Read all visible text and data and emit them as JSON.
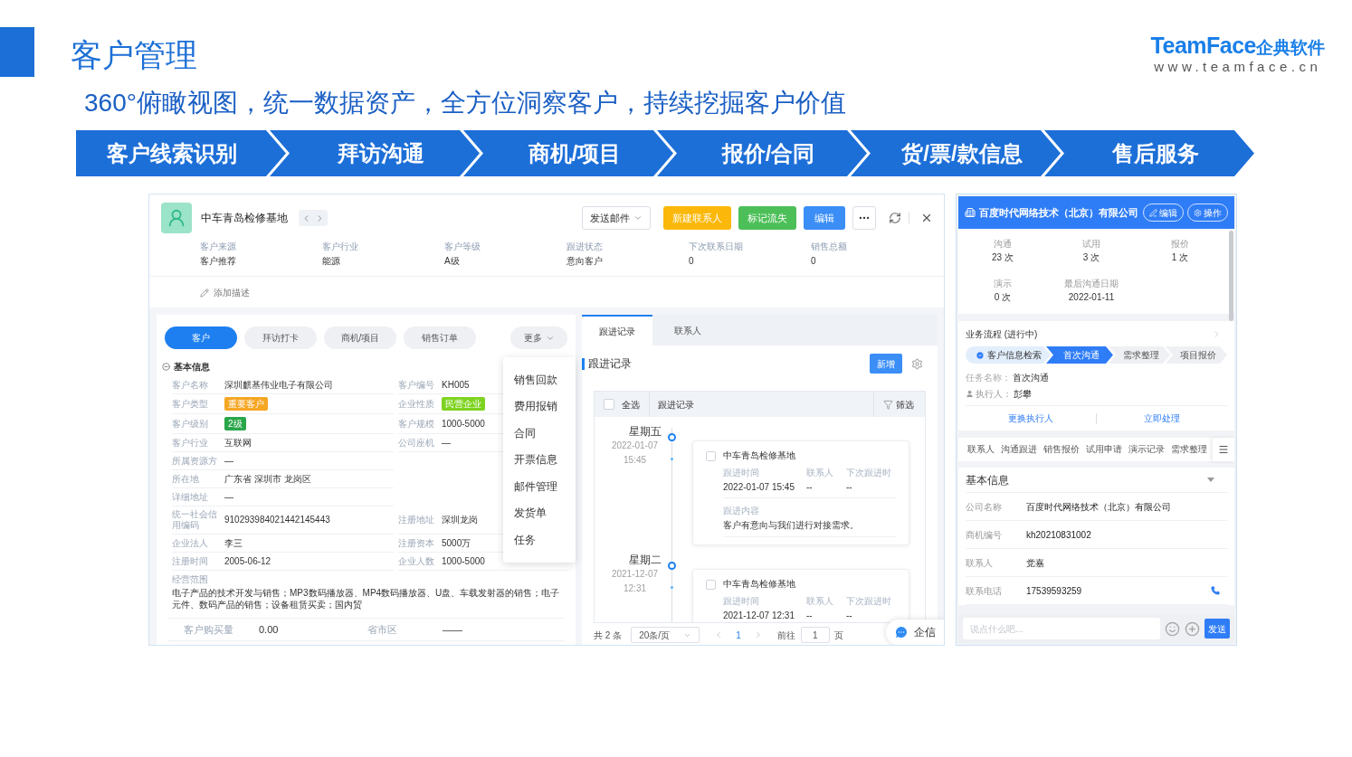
{
  "header": {
    "title": "客户管理",
    "brand_name": "TeamFace",
    "brand_cn": "企典软件",
    "brand_url": "www.teamface.cn",
    "subtitle": "360°俯瞰视图，统一数据资产，全方位洞察客户，持续挖掘客户价值"
  },
  "process_steps": [
    "客户线索识别",
    "拜访沟通",
    "商机/项目",
    "报价/合同",
    "货/票/款信息",
    "售后服务"
  ],
  "customer_detail": {
    "title": "中车青岛检修基地",
    "actions": [
      {
        "label": "发送邮件",
        "kind": "dropdown"
      },
      {
        "label": "新建联系人",
        "kind": "warning"
      },
      {
        "label": "标记流失",
        "kind": "success"
      },
      {
        "label": "编辑",
        "kind": "primary"
      }
    ],
    "summary_fields": [
      {
        "label": "客户来源",
        "value": "客户推荐"
      },
      {
        "label": "客户行业",
        "value": "能源"
      },
      {
        "label": "客户等级",
        "value": "A级"
      },
      {
        "label": "跟进状态",
        "value": "意向客户"
      },
      {
        "label": "下次联系日期",
        "value": "0"
      },
      {
        "label": "销售总额",
        "value": "0"
      }
    ],
    "add_description": "添加描述",
    "tabs": [
      {
        "label": "客户",
        "selected": true
      },
      {
        "label": "拜访打卡",
        "selected": false
      },
      {
        "label": "商机/项目",
        "selected": false
      },
      {
        "label": "销售订单",
        "selected": false
      }
    ],
    "more_button": "更多",
    "more_menu": [
      "销售回款",
      "费用报销",
      "合同",
      "开票信息",
      "邮件管理",
      "发货单",
      "任务"
    ],
    "section_title": "基本信息",
    "info_rows": [
      {
        "left": {
          "label": "客户名称",
          "value": "深圳麒基伟业电子有限公司",
          "kind": "text"
        },
        "right": {
          "label": "客户编号",
          "value": "KH005",
          "kind": "text"
        }
      },
      {
        "left": {
          "label": "客户类型",
          "value": "重要客户",
          "kind": "tag",
          "color": "#f5a623"
        },
        "right": {
          "label": "企业性质",
          "value": "民营企业",
          "kind": "tag",
          "color": "#7ed321"
        }
      },
      {
        "left": {
          "label": "客户级别",
          "value": "2级",
          "kind": "tag",
          "color": "#2aa64a"
        },
        "right": {
          "label": "客户规模",
          "value": "1000-5000",
          "kind": "text"
        }
      },
      {
        "left": {
          "label": "客户行业",
          "value": "互联网",
          "kind": "text"
        },
        "right": {
          "label": "公司座机",
          "value": "—",
          "kind": "text"
        }
      },
      {
        "left": {
          "label": "所属资源方",
          "value": "—",
          "kind": "text"
        }
      },
      {
        "left": {
          "label": "所在地",
          "value": "广东省 深圳市 龙岗区",
          "kind": "text"
        }
      },
      {
        "left": {
          "label": "详细地址",
          "value": "—",
          "kind": "text"
        }
      },
      {
        "left": {
          "label": "统一社会信用编码",
          "value": "910293984021442145443",
          "kind": "text"
        },
        "right": {
          "label": "注册地址",
          "value": "深圳龙岗",
          "kind": "text"
        }
      },
      {
        "left": {
          "label": "企业法人",
          "value": "李三",
          "kind": "text"
        },
        "right": {
          "label": "注册资本",
          "value": "5000万",
          "kind": "text"
        }
      },
      {
        "left": {
          "label": "注册时间",
          "value": "2005-06-12",
          "kind": "text"
        },
        "right": {
          "label": "企业人数",
          "value": "1000-5000",
          "kind": "text"
        }
      }
    ],
    "business_scope": {
      "label": "经营范围",
      "value": "电子产品的技术开发与销售；MP3数码播放器、MP4数码播放器、U盘、车载发射器的销售；电子元件、数码产品的销售；设备租赁买卖；国内贸"
    },
    "totals": [
      {
        "label": "客户购买量",
        "value": "0.00"
      },
      {
        "label": "省市区",
        "value": "——"
      }
    ]
  },
  "follow_up": {
    "tabs": [
      {
        "label": "跟进记录",
        "selected": true
      },
      {
        "label": "联系人",
        "selected": false
      }
    ],
    "title": "跟进记录",
    "add_button": "新增",
    "select_all": "全选",
    "select_all_checked": false,
    "column": "跟进记录",
    "filter": "筛选",
    "records": [
      {
        "weekday": "星期五",
        "date": "2022-01-07",
        "time": "15:45",
        "company": "中车青岛检修基地",
        "checked": false,
        "fields": [
          {
            "label": "跟进时间",
            "value": "2022-01-07 15:45"
          },
          {
            "label": "联系人",
            "value": "--"
          },
          {
            "label": "下次跟进时",
            "value": "--"
          }
        ],
        "content_label": "跟进内容",
        "content": "客户有意向与我们进行对接需求。"
      },
      {
        "weekday": "星期二",
        "date": "2021-12-07",
        "time": "12:31",
        "company": "中车青岛检修基地",
        "checked": false,
        "fields": [
          {
            "label": "跟进时间",
            "value": "2021-12-07 12:31"
          },
          {
            "label": "联系人",
            "value": "--"
          },
          {
            "label": "下次跟进时",
            "value": "--"
          }
        ]
      }
    ],
    "pagination": {
      "total": "共 2 条",
      "page_size": "20条/页",
      "current_page": "1",
      "goto_label": "前往",
      "goto_value": "1",
      "goto_suffix": "页"
    },
    "chat_button": "企信"
  },
  "opportunity": {
    "company": "百度时代网络技术（北京）有限公司",
    "header_buttons": [
      {
        "label": "编辑",
        "kind": "edit"
      },
      {
        "label": "操作",
        "kind": "settings"
      }
    ],
    "stats": [
      {
        "label": "沟通",
        "value": "23 次"
      },
      {
        "label": "试用",
        "value": "3 次"
      },
      {
        "label": "报价",
        "value": "1 次"
      },
      {
        "label": "演示",
        "value": "0 次"
      },
      {
        "label": "最后沟通日期",
        "value": "2022-01-11"
      }
    ],
    "workflow": {
      "title": "业务流程 (进行中)",
      "steps": [
        {
          "label": "客户信息检索",
          "completed": true,
          "selected": false
        },
        {
          "label": "首次沟通",
          "completed": false,
          "selected": true
        },
        {
          "label": "需求整理",
          "completed": false,
          "selected": false
        },
        {
          "label": "项目报价",
          "completed": false,
          "selected": false
        }
      ],
      "task_label": "任务名称：",
      "task": "首次沟通",
      "assignee_label": "执行人：",
      "assignee": "彭攀",
      "actions": [
        "更换执行人",
        "立即处理"
      ]
    },
    "tabs": [
      "联系人",
      "沟通跟进",
      "销售报价",
      "试用申请",
      "演示记录",
      "需求整理"
    ],
    "info_title": "基本信息",
    "info_rows": [
      {
        "label": "公司名称",
        "value": "百度时代网络技术（北京）有限公司",
        "kind": "text"
      },
      {
        "label": "商机编号",
        "value": "kh20210831002",
        "kind": "text"
      },
      {
        "label": "联系人",
        "value": "党嘉",
        "kind": "text"
      },
      {
        "label": "联系电话",
        "value": "17539593259",
        "kind": "phone"
      }
    ],
    "message_placeholder": "说点什么吧...",
    "send_button": "发送"
  }
}
